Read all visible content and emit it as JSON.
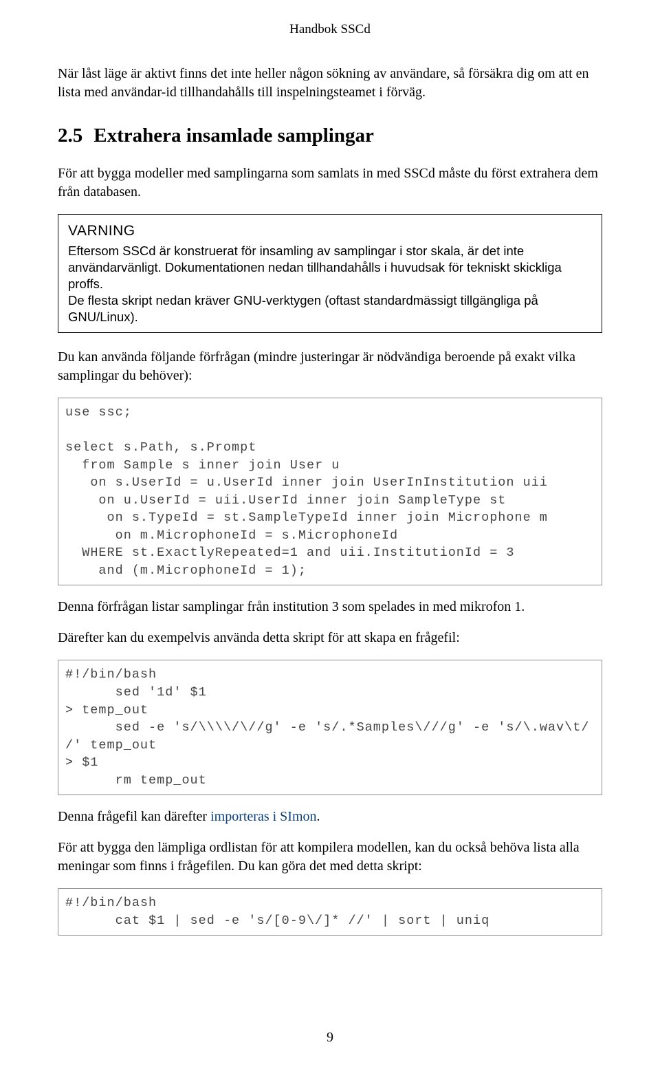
{
  "header": {
    "running": "Handbok SSCd"
  },
  "body": {
    "p1": "När låst läge är aktivt finns det inte heller någon sökning av användare, så försäkra dig om att en lista med användar-id tillhandahålls till inspelningsteamet i förväg.",
    "section": {
      "num": "2.5",
      "title": "Extrahera insamlade samplingar"
    },
    "p2": "För att bygga modeller med samplingarna som samlats in med SSCd måste du först extrahera dem från databasen.",
    "warn": {
      "title": "VARNING",
      "text": "Eftersom SSCd är konstruerat för insamling av samplingar i stor skala, är det inte användarvänligt. Dokumentationen nedan tillhandahålls i huvudsak för tekniskt skickliga proffs.\nDe flesta skript nedan kräver GNU-verktygen (oftast standardmässigt tillgängliga på GNU/Linux)."
    },
    "p3": "Du kan använda följande förfrågan (mindre justeringar är nödvändiga beroende på exakt vilka samplingar du behöver):",
    "code1": "use ssc;\n\nselect s.Path, s.Prompt\n  from Sample s inner join User u\n   on s.UserId = u.UserId inner join UserInInstitution uii\n    on u.UserId = uii.UserId inner join SampleType st\n     on s.TypeId = st.SampleTypeId inner join Microphone m\n      on m.MicrophoneId = s.MicrophoneId\n  WHERE st.ExactlyRepeated=1 and uii.InstitutionId = 3\n    and (m.MicrophoneId = 1);",
    "p4": "Denna förfrågan listar samplingar från institution 3 som spelades in med mikrofon 1.",
    "p5": "Därefter kan du exempelvis använda detta skript för att skapa en frågefil:",
    "code2": "#!/bin/bash\n      sed '1d' $1\n> temp_out\n      sed -e 's/\\\\\\\\/\\//g' -e 's/.*Samples\\///g' -e 's/\\.wav\\t/ /' temp_out\n> $1\n      rm temp_out",
    "p6a": "Denna frågefil kan därefter ",
    "p6link": "importeras i SImon",
    "p6b": ".",
    "p7": "För att bygga den lämpliga ordlistan för att kompilera modellen, kan du också behöva lista alla meningar som finns i frågefilen. Du kan göra det med detta skript:",
    "code3": "#!/bin/bash\n      cat $1 | sed -e 's/[0-9\\/]* //' | sort | uniq"
  },
  "footer": {
    "page_num": "9"
  }
}
